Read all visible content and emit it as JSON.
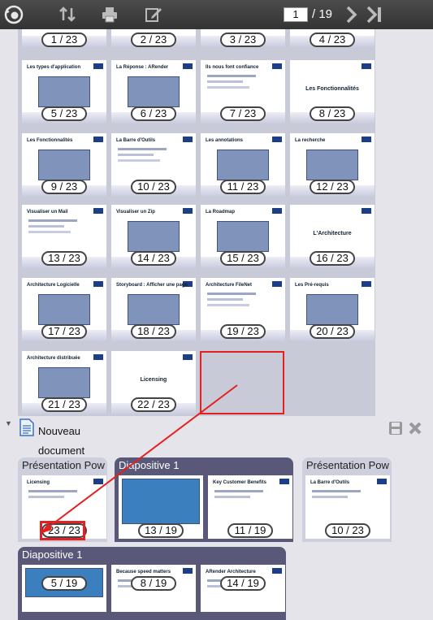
{
  "toolbar": {
    "current_page": "1",
    "total_pages": "/ 19",
    "colors": {
      "bg": "#3c3c3c",
      "icon": "#bbbbbb"
    }
  },
  "thumbs": [
    {
      "label": "1 / 23",
      "title": ""
    },
    {
      "label": "2 / 23",
      "title": ""
    },
    {
      "label": "3 / 23",
      "title": ""
    },
    {
      "label": "4 / 23",
      "title": ""
    },
    {
      "label": "5 / 23",
      "title": "Les types d'application"
    },
    {
      "label": "6 / 23",
      "title": "La Réponse : ARender"
    },
    {
      "label": "7 / 23",
      "title": "Ils nous font confiance"
    },
    {
      "label": "8 / 23",
      "title": "Les Fonctionnalités"
    },
    {
      "label": "9 / 23",
      "title": "Les Fonctionnalités"
    },
    {
      "label": "10 / 23",
      "title": "La Barre d'Outils"
    },
    {
      "label": "11 / 23",
      "title": "Les annotations"
    },
    {
      "label": "12 / 23",
      "title": "La recherche"
    },
    {
      "label": "13 / 23",
      "title": "Visualiser un Mail"
    },
    {
      "label": "14 / 23",
      "title": "Visualiser un Zip"
    },
    {
      "label": "15 / 23",
      "title": "La Roadmap"
    },
    {
      "label": "16 / 23",
      "title": "L'Architecture"
    },
    {
      "label": "17 / 23",
      "title": "Architecture Logicielle"
    },
    {
      "label": "18 / 23",
      "title": "Storyboard : Afficher une page"
    },
    {
      "label": "19 / 23",
      "title": "Architecture FileNet"
    },
    {
      "label": "20 / 23",
      "title": "Les Pré-requis"
    },
    {
      "label": "21 / 23",
      "title": "Architecture distribuée"
    },
    {
      "label": "22 / 23",
      "title": "Licensing"
    }
  ],
  "document": {
    "name": "Nouveau document"
  },
  "groups": [
    {
      "header": "Présentation Pow",
      "items": [
        {
          "label": "23 / 23",
          "title": "Licensing"
        }
      ]
    },
    {
      "header": "Diapositive 1",
      "items": [
        {
          "label": "13 / 19",
          "title": ""
        },
        {
          "label": "11 / 19",
          "title": "Key Customer Benefits"
        }
      ]
    },
    {
      "header": "Présentation Pow",
      "items": [
        {
          "label": "10 / 23",
          "title": "La Barre d'Outils"
        }
      ]
    },
    {
      "header": "Diapositive 1",
      "items": [
        {
          "label": "5 / 19",
          "title": ""
        },
        {
          "label": "8 / 19",
          "title": "Because speed matters"
        },
        {
          "label": "14 / 19",
          "title": "ARender Architecture"
        }
      ]
    }
  ],
  "colors": {
    "highlight": "#e52020",
    "group_dark": "#5a5878",
    "group_light": "#cdd0dc",
    "panel": "#c9cad8"
  }
}
